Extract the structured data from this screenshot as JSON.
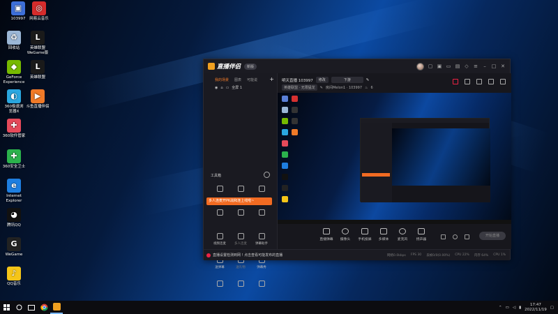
{
  "desktop": {
    "icons": [
      {
        "label": "103997",
        "color": "#3d6fd8",
        "glyph": "▣"
      },
      {
        "label": "网易云音乐",
        "color": "#d62c2c",
        "glyph": "◎"
      },
      {
        "label": "回收站",
        "color": "#9bb7d6",
        "glyph": "♻"
      },
      {
        "label": "英雄联盟\nWeGame版",
        "color": "#1a1a1a",
        "glyph": "L"
      },
      {
        "label": "GeForce\nExperience",
        "color": "#76b900",
        "glyph": "◆"
      },
      {
        "label": "英雄联盟",
        "color": "#1a1a1a",
        "glyph": "L"
      },
      {
        "label": "360极速浏\n览器X",
        "color": "#2aa7e0",
        "glyph": "◐"
      },
      {
        "label": "斗鱼直播伴侣",
        "color": "#f07a28",
        "glyph": "▶"
      },
      {
        "label": "360软件管家",
        "color": "#e64a5a",
        "glyph": "✚"
      },
      {
        "label": "360安全卫士",
        "color": "#2bb24c",
        "glyph": "✚"
      },
      {
        "label": "Internet\nExplorer",
        "color": "#1e7ee0",
        "glyph": "e"
      },
      {
        "label": "腾讯QQ",
        "color": "#111111",
        "glyph": "◕"
      },
      {
        "label": "WeGame",
        "color": "#222222",
        "glyph": "G"
      },
      {
        "label": "QQ音乐",
        "color": "#f5c518",
        "glyph": "♪"
      }
    ]
  },
  "app": {
    "title": "直播伴侣",
    "version_badge": "新版",
    "titlebar_icons": [
      "gift-icon",
      "shop-icon",
      "screen-icon",
      "chat-icon",
      "bell-icon",
      "menu-icon",
      "minimize-icon",
      "maximize-icon",
      "close-icon"
    ],
    "left": {
      "tabs": [
        {
          "label": "我的场景",
          "active": true
        },
        {
          "label": "图表",
          "active": false
        },
        {
          "label": "可能说",
          "active": false
        }
      ],
      "scene": {
        "label": "全屏 1"
      },
      "tools_header": "工具箱",
      "promo": "多人连麦开PK战和连上线啦~",
      "tools": [
        {
          "label": "",
          "dim": false
        },
        {
          "label": "",
          "dim": false
        },
        {
          "label": "",
          "dim": false
        },
        {
          "label": "",
          "dim": false
        },
        {
          "label": "",
          "dim": false
        },
        {
          "label": "",
          "dim": false
        },
        {
          "label": "视频连麦",
          "dim": false
        },
        {
          "label": "多人连麦",
          "dim": true
        },
        {
          "label": "弹幕助手",
          "dim": false
        },
        {
          "label": "送弹幕",
          "dim": false
        },
        {
          "label": "送礼物",
          "dim": true
        },
        {
          "label": "弹幕秀",
          "dim": false
        },
        {
          "label": "",
          "dim": false
        },
        {
          "label": "",
          "dim": false
        },
        {
          "label": "",
          "dim": false
        }
      ]
    },
    "info": {
      "room_title": "明天直播 103997",
      "edit_chip": "修改",
      "category_chip": "下游",
      "game_chip": "英雄联盟 · 无限猛龙",
      "room_id": "房间Melon1 · 103997",
      "viewers": "6"
    },
    "toolbar": {
      "buttons": [
        {
          "label": "直播弹幕",
          "round": false
        },
        {
          "label": "摄像头",
          "round": true
        },
        {
          "label": "手机投屏",
          "round": false
        },
        {
          "label": "多媒体",
          "round": false
        },
        {
          "label": "麦克风",
          "round": true
        },
        {
          "label": "扬声器",
          "round": false
        }
      ],
      "start_label": "开始直播"
    },
    "status": {
      "warning": "直播设置检测到网 ! 点击查看可能发布的直播",
      "stats": [
        "网络0.0kbps",
        "FPS 30",
        "丢帧0/0(0.00%)",
        "CPU 22%",
        "内存 64%",
        "CPU 1%"
      ]
    }
  },
  "taskbar": {
    "time": "17:47",
    "date": "2022/11/19"
  }
}
